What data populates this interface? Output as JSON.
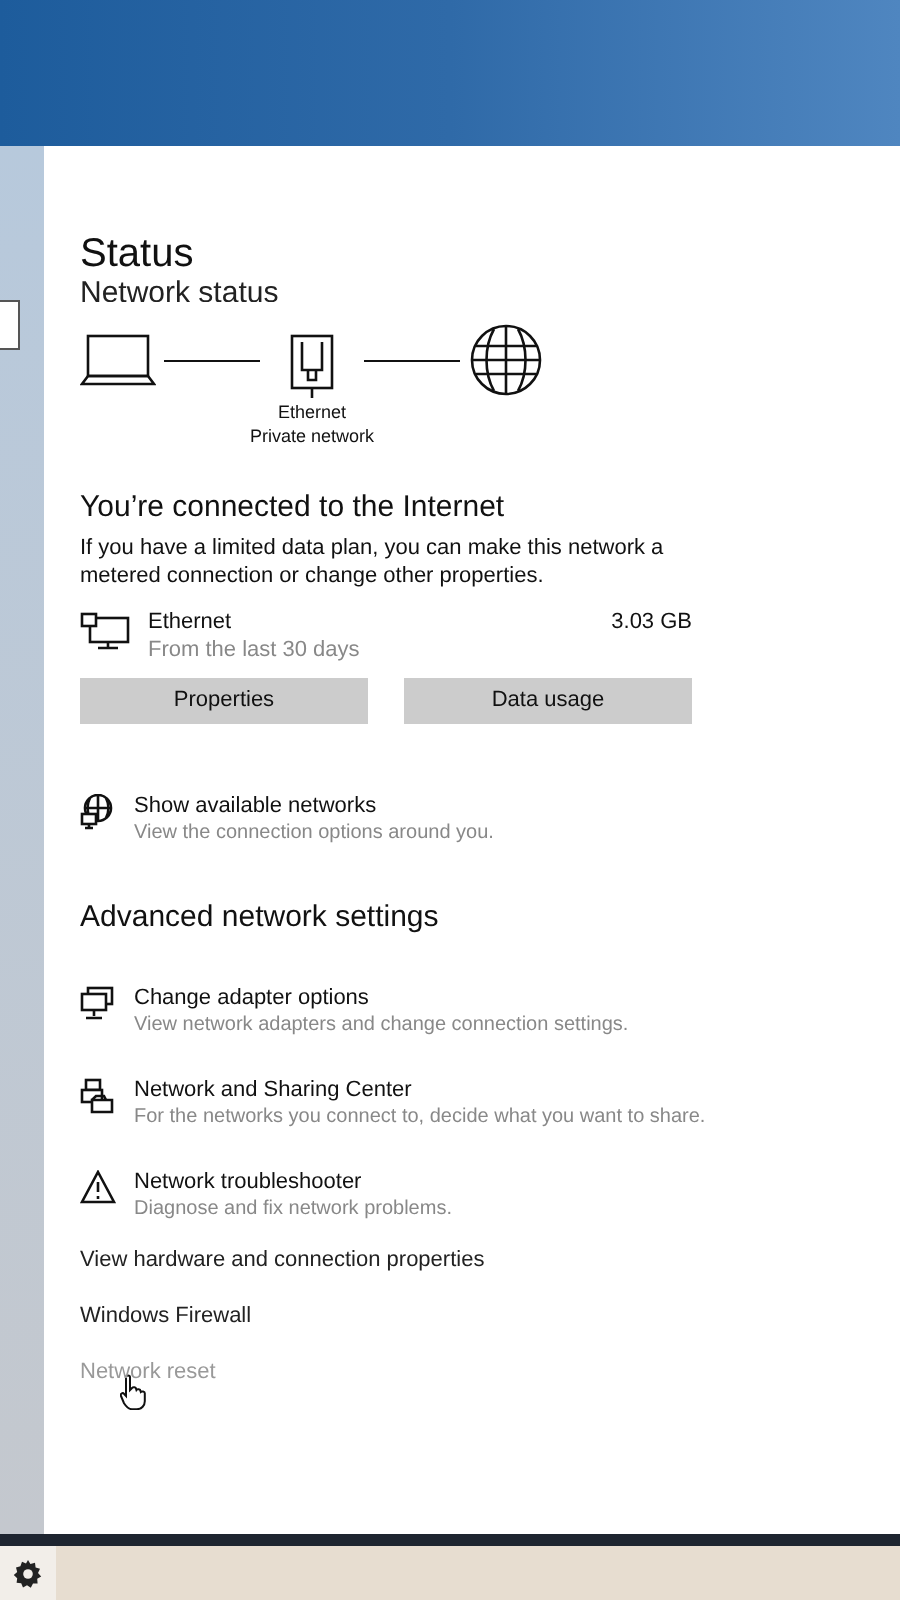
{
  "page_title": "Status",
  "section_title": "Network status",
  "diagram": {
    "adapter_name": "Ethernet",
    "network_type": "Private network"
  },
  "connection": {
    "heading": "You’re connected to the Internet",
    "description": "If you have a limited data plan, you can make this network a metered connection or change other properties."
  },
  "adapter": {
    "name": "Ethernet",
    "period": "From the last 30 days",
    "usage": "3.03 GB"
  },
  "buttons": [
    "Properties",
    "Data usage"
  ],
  "show_networks": {
    "title": "Show available networks",
    "subtitle": "View the connection options around you.",
    "kind": "globe-monitor"
  },
  "advanced": {
    "heading": "Advanced network settings",
    "items": [
      {
        "title": "Change adapter options",
        "subtitle": "View network adapters and change connection settings.",
        "kind": "monitors"
      },
      {
        "title": "Network and Sharing Center",
        "subtitle": "For the networks you connect to, decide what you want to share.",
        "kind": "sharing"
      },
      {
        "title": "Network troubleshooter",
        "subtitle": "Diagnose and fix network problems.",
        "kind": "warning"
      }
    ]
  },
  "links": [
    {
      "label": "View hardware and connection properties",
      "hovered": false
    },
    {
      "label": "Windows Firewall",
      "hovered": false
    },
    {
      "label": "Network reset",
      "hovered": true
    }
  ]
}
